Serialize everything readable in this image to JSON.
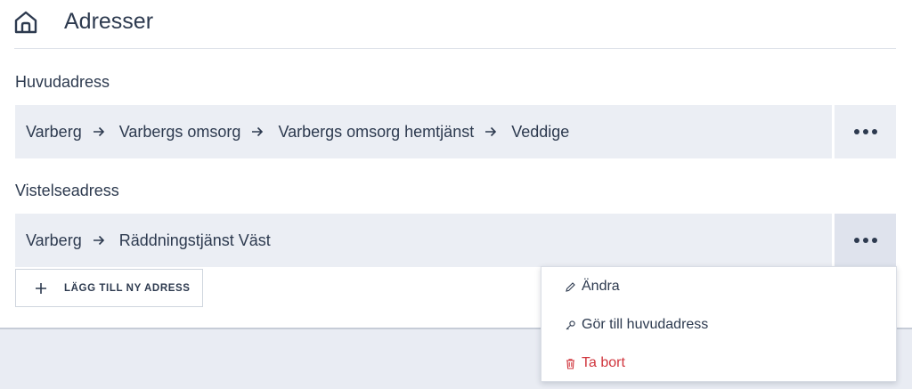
{
  "header": {
    "title": "Adresser",
    "home_icon": "home-icon"
  },
  "main_address": {
    "label": "Huvudadress",
    "path": [
      "Varberg",
      "Varbergs omsorg",
      "Varbergs omsorg hemtjänst",
      "Veddige"
    ]
  },
  "stay_address": {
    "label": "Vistelseadress",
    "path": [
      "Varberg",
      "Räddningstjänst Väst"
    ]
  },
  "add_button": {
    "label": "LÄGG TILL NY ADRESS",
    "icon": "plus-icon"
  },
  "context_menu": {
    "items": [
      {
        "label": "Ändra",
        "icon": "pencil-icon"
      },
      {
        "label": "Gör till huvudadress",
        "icon": "key-icon"
      },
      {
        "label": "Ta bort",
        "icon": "trash-icon",
        "color": "#d0353d"
      }
    ]
  },
  "colors": {
    "row_bg": "#ebeef4",
    "text": "#2d3a4f",
    "danger": "#d0353d",
    "footer_bg": "#e9ecf3"
  }
}
